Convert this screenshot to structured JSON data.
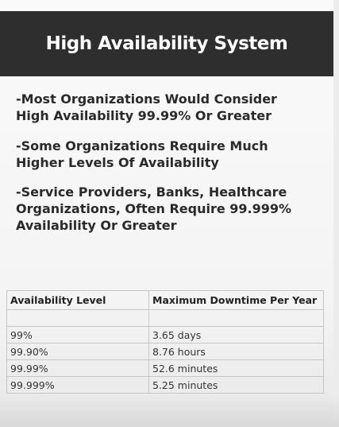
{
  "title": "High Availability System",
  "bullets": [
    {
      "line1": "-Most Organizations Would Consider",
      "line2": "High Availability 99.99% Or Greater"
    },
    {
      "line1": "-Some Organizations Require Much",
      "line2": "Higher Levels Of Availability"
    },
    {
      "line1": "-Service Providers, Banks, Healthcare",
      "line2": "Organizations, Often Require 99.999%",
      "line3": "Availability Or Greater"
    }
  ],
  "table": {
    "headers": [
      "Availability Level",
      "Maximum Downtime Per Year"
    ],
    "rows": [
      [
        "99%",
        "3.65 days"
      ],
      [
        "99.90%",
        "8.76 hours"
      ],
      [
        "99.99%",
        "52.6 minutes"
      ],
      [
        "99.999%",
        "5.25 minutes"
      ]
    ]
  },
  "colors": {
    "title_bar": "#2e2e2e",
    "title_text": "#ffffff",
    "body_text": "#2a2a2a"
  }
}
